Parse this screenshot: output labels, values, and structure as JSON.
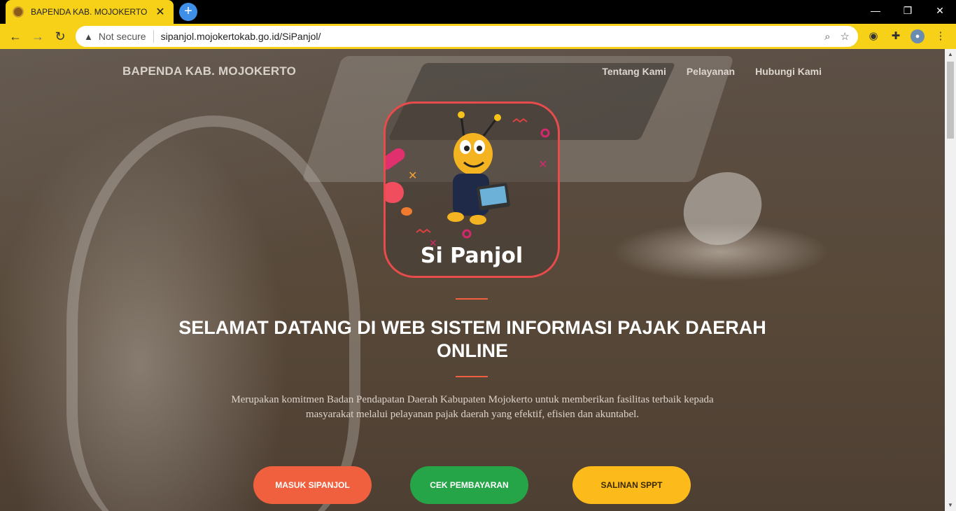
{
  "browser": {
    "tab_title": "BAPENDA KAB. MOJOKERTO",
    "tab_close": "✕",
    "new_tab": "+",
    "security_label": "Not secure",
    "url": "sipanjol.mojokertokab.go.id/SiPanjol/",
    "window_controls": {
      "minimize": "—",
      "restore": "❐",
      "close": "✕"
    },
    "nav": {
      "back": "←",
      "forward": "→",
      "reload": "↻"
    }
  },
  "site": {
    "brand": "BAPENDA KAB. MOJOKERTO",
    "nav_links": [
      "Tentang Kami",
      "Pelayanan",
      "Hubungi Kami"
    ],
    "logo_text": "Si Panjol",
    "headline": "SELAMAT DATANG DI WEB SISTEM INFORMASI PAJAK DAERAH ONLINE",
    "description": "Merupakan komitmen Badan Pendapatan Daerah Kabupaten Mojokerto untuk memberikan fasilitas terbaik kepada masyarakat melalui pelayanan pajak daerah yang efektif, efisien dan akuntabel.",
    "buttons": {
      "masuk": "MASUK SIPANJOL",
      "cek": "CEK PEMBAYARAN",
      "salinan": "SALINAN SPPT"
    }
  },
  "colors": {
    "accent": "#f05f40",
    "green": "#25a548",
    "yellow": "#fdbb1b",
    "chrome": "#f7d117"
  }
}
